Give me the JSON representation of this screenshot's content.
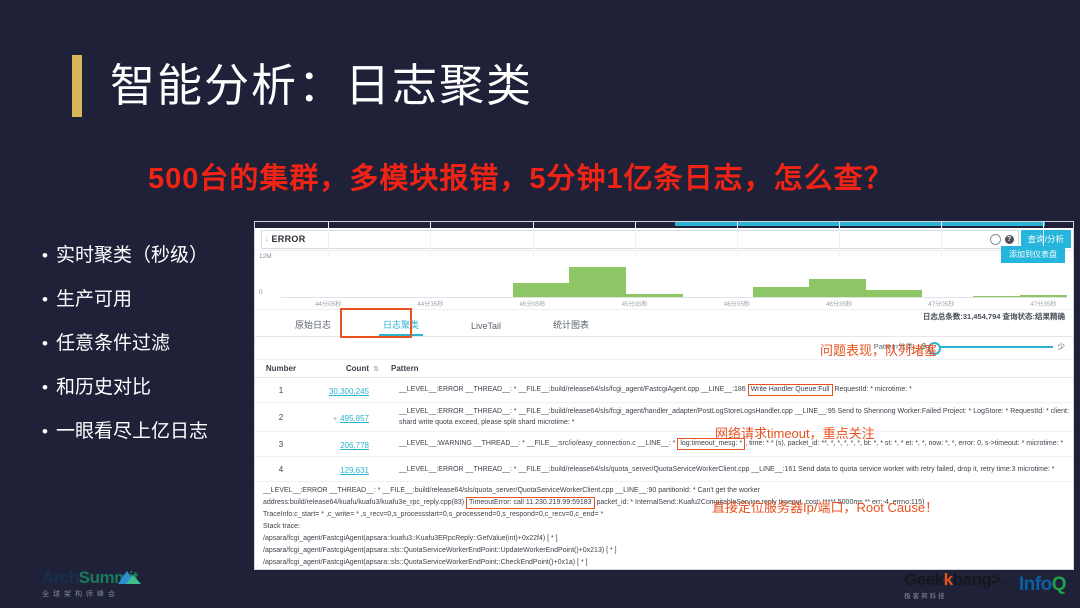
{
  "slide": {
    "title": "智能分析：日志聚类",
    "subtitle": "500台的集群，多模块报错，5分钟1亿条日志，怎么查？",
    "bullet_marker": "•",
    "bullets": [
      "实时聚类（秒级）",
      "生产可用",
      "任意条件过滤",
      "和历史对比",
      "一眼看尽上亿日志"
    ]
  },
  "console": {
    "search": {
      "value": "ERROR",
      "caret": "↓",
      "gear_icon": "gear-icon",
      "help_icon": "help-icon",
      "help_glyph": "?"
    },
    "query_button": "查询/分析",
    "chart": {
      "y_top": "12M",
      "y_bottom": "0"
    },
    "tabs": [
      {
        "label": "原始日志",
        "active": false
      },
      {
        "label": "日志聚类",
        "active": true
      },
      {
        "label": "LiveTail",
        "active": false
      },
      {
        "label": "统计图表",
        "active": false
      }
    ],
    "log_stats": "日志总条数:31,454,794  查询状态:结果精确",
    "pattern": {
      "label": "Pattern分类:",
      "more": "多",
      "less": "少"
    },
    "add_dashboard_button": "添加到仪表盘",
    "table": {
      "headers": {
        "number": "Number",
        "count": "Count",
        "pattern": "Pattern",
        "sort_icon": "sort-icon"
      },
      "rows": [
        {
          "number": "1",
          "count": "30,300,245",
          "expander": "",
          "pattern_pre": "__LEVEL__:ERROR __THREAD__: * __FILE__:build/release64/sls/fcgi_agent/FastcgiAgent.cpp __LINE__:186 ",
          "pattern_highlight": "Write Handler Queue:Full",
          "pattern_post": " RequestId: * microtime: *"
        },
        {
          "number": "2",
          "count": "495,857",
          "expander": "+",
          "pattern_pre": "__LEVEL__:ERROR __THREAD__: * __FILE__:build/release64/sls/fcgi_agent/handler_adapter/PostLogStoreLogsHandler.cpp __LINE__:95 Send to Shennong Worker:Failed Project: * LogStore: * RequestId: * client:shard write quota exceed, please split shard microtime: *",
          "pattern_highlight": "",
          "pattern_post": ""
        },
        {
          "number": "3",
          "count": "206,778",
          "expander": "",
          "pattern_pre": "__LEVEL__:WARNING __THREAD__: * __FILE__:src/io/easy_connection.c __LINE__: * ",
          "pattern_highlight": "log:timeout_mesg: *",
          "pattern_post": ", time: * * (s), packet_id: **, *, *, *, *, *, bt: *, * st: *, * et: *, *, now: *, *, error: 0, s->timeout: * microtime: *"
        },
        {
          "number": "4",
          "count": "129,631",
          "expander": "",
          "pattern_pre": "__LEVEL__:ERROR __THREAD__: * __FILE__:build/release64/sls/quota_server/QuotaServiceWorkerClient.cpp __LINE__:161 Send data to quota service worker with retry failed, drop it, retry time:3 microtime: *",
          "pattern_highlight": "",
          "pattern_post": ""
        }
      ],
      "detail": {
        "line1": "__LEVEL__:ERROR __THREAD__: * __FILE__:build/release64/sls/quota_server/QuotaServiceWorkerClient.cpp __LINE__:90 partitionId: * Can't get the worker",
        "line2_pre": "address:build/release64/kuafu/kuafu3/kuafu3e_rpc_reply.cpp(83) ",
        "line2_highlight": "TimeoutError: call 11.230.219.99:59183",
        "line2_post": " packet_id: * InternalSend::Kuafu2CompitableService reply timeout, cost: ***** 5000ms ** err:-4, errno:115)",
        "line3": "TraceInfo:c_start= * ,c_write= * ,s_recv=0,s_processstart=0,s_processend=0,s_respond=0,c_recv=0,c_end= *",
        "line4": "Stack trace:",
        "line5": "/apsara/fcgi_agent/FastcgiAgent(apsara::kuafu3::Kuafu3ERpcReply::GetValue(int)+0x22f4) [ * ]",
        "line6": "/apsara/fcgi_agent/FastcgiAgent(apsara::sls::QuotaServiceWorkerEndPoint::UpdateWorkerEndPoint()+0x213) [ * ]",
        "line7": "/apsara/fcgi_agent/FastcgiAgent(apsara::sls::QuotaServiceWorkerEndPoint::CheckEndPoint()+0x1a) [ * ]"
      }
    }
  },
  "annotations": [
    {
      "text": "问题表现，队列堵塞"
    },
    {
      "text": "网络请求timeout，重点关注"
    },
    {
      "text": "直接定位服务器Ip/端口，Root Cause！"
    }
  ],
  "footer": {
    "left": {
      "brand_a": "Arch",
      "brand_b": "Summit",
      "tagline": "全球架构师峰会"
    },
    "right": {
      "geek_a": "Geek",
      "geek_k": "k",
      "geek_b": "bang>.",
      "geek_sub": "极客邦科技",
      "infoq_a": "Info",
      "infoq_q": "Q"
    }
  },
  "chart_data": {
    "type": "bar",
    "title": "",
    "xlabel": "",
    "ylabel": "",
    "ylim": [
      0,
      12000000
    ],
    "y_ticks": [
      "0",
      "12M"
    ],
    "grid": true,
    "legend": "none",
    "bar_color": "#8dc765",
    "categories": [
      "44分05秒",
      "44分35秒",
      "45分05秒",
      "45分35秒",
      "46分05秒",
      "46分35秒",
      "47分05秒",
      "47分35秒"
    ],
    "tick_positions_pct": [
      6,
      19,
      32,
      45,
      58,
      71,
      84,
      97
    ],
    "bars": [
      {
        "x_pct": 29.5,
        "width_pct": 7.2,
        "height_pct": 34
      },
      {
        "x_pct": 36.7,
        "width_pct": 7.2,
        "height_pct": 76
      },
      {
        "x_pct": 43.9,
        "width_pct": 7.2,
        "height_pct": 7
      },
      {
        "x_pct": 60.0,
        "width_pct": 7.2,
        "height_pct": 24
      },
      {
        "x_pct": 67.2,
        "width_pct": 7.2,
        "height_pct": 46
      },
      {
        "x_pct": 74.4,
        "width_pct": 7.2,
        "height_pct": 18
      },
      {
        "x_pct": 88.0,
        "width_pct": 6.0,
        "height_pct": 2
      },
      {
        "x_pct": 94.0,
        "width_pct": 6.0,
        "height_pct": 4
      }
    ]
  }
}
